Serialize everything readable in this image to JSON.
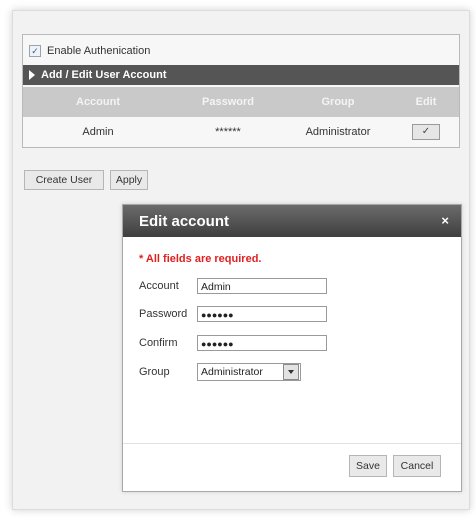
{
  "user_section": {
    "enable_auth_label": "Enable Authenication",
    "enable_auth_checked": true,
    "section_title": "Add / Edit User Account",
    "columns": [
      "Account",
      "Password",
      "Group",
      "Edit"
    ],
    "rows": [
      {
        "account": "Admin",
        "password": "******",
        "group": "Administrator",
        "edit_label": "✓"
      }
    ]
  },
  "buttons": {
    "create_user": "Create User",
    "apply": "Apply"
  },
  "dialog": {
    "title": "Edit account",
    "close_glyph": "×",
    "required_note": "* All fields are required.",
    "fields": {
      "account_label": "Account",
      "account_value": "Admin",
      "password_label": "Password",
      "password_value": "●●●●●●",
      "confirm_label": "Confirm",
      "confirm_value": "●●●●●●",
      "group_label": "Group",
      "group_value": "Administrator"
    },
    "save_label": "Save",
    "cancel_label": "Cancel"
  },
  "colors": {
    "section_bar": "#555555",
    "table_header": "#c9c9c9",
    "dialog_title": "#4a4a4a",
    "required_text": "#e02020"
  }
}
